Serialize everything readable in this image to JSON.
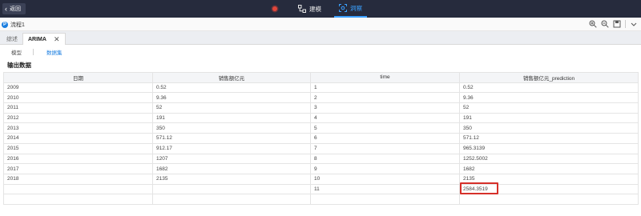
{
  "topbar": {
    "back_label": "返回",
    "tabs": [
      {
        "label": "建模",
        "icon": "flow-nodes-icon"
      },
      {
        "label": "洞察",
        "icon": "insight-icon",
        "active": true
      }
    ]
  },
  "flowbar": {
    "flow_name": "流程1",
    "tools": [
      "zoom-in-icon",
      "zoom-out-icon",
      "save-icon",
      "chevron-down-icon"
    ]
  },
  "doc_tabs": [
    {
      "label": "综述"
    },
    {
      "label": "ARIMA",
      "active": true,
      "closable": true
    }
  ],
  "subtabs": [
    {
      "label": "模型"
    },
    {
      "label": "数据集",
      "active": true
    }
  ],
  "section_title": "输出数据",
  "table": {
    "headers": [
      "日期",
      "销售额亿元",
      "time",
      "销售额亿元_prediction"
    ],
    "rows": [
      [
        "2009",
        "0.52",
        "1",
        "0.52"
      ],
      [
        "2010",
        "9.36",
        "2",
        "9.36"
      ],
      [
        "2011",
        "52",
        "3",
        "52"
      ],
      [
        "2012",
        "191",
        "4",
        "191"
      ],
      [
        "2013",
        "350",
        "5",
        "350"
      ],
      [
        "2014",
        "571.12",
        "6",
        "571.12"
      ],
      [
        "2015",
        "912.17",
        "7",
        "965.3139"
      ],
      [
        "2016",
        "1207",
        "8",
        "1252.5002"
      ],
      [
        "2017",
        "1682",
        "9",
        "1682"
      ],
      [
        "2018",
        "2135",
        "10",
        "2135"
      ],
      [
        "",
        "",
        "11",
        "2584.3519"
      ],
      [
        "",
        "",
        "",
        ""
      ]
    ],
    "highlighted_value": "2584.3519"
  },
  "colors": {
    "topbar_bg": "#262b3d",
    "accent": "#1a7ee0",
    "active_nav": "#3aa0ff",
    "highlight_border": "#d6302a",
    "record_dot": "#e2463a"
  }
}
